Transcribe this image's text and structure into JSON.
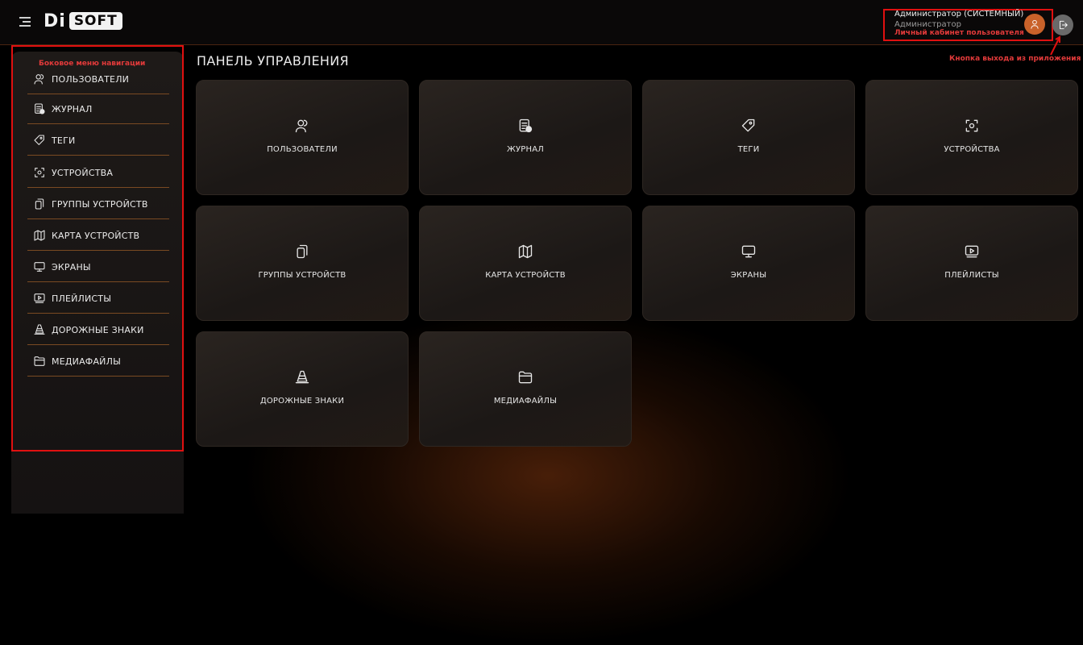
{
  "header": {
    "logo_di": "Di",
    "logo_soft": "SOFT",
    "user_name": "Администратор (СИСТЕМНЫЙ)",
    "user_role": "Администратор",
    "user_cabinet_annotation": "Личный кабинет пользователя",
    "logout_annotation": "Кнопка выхода из приложения"
  },
  "sidebar": {
    "annotation": "Боковое меню навигации",
    "items": [
      {
        "label": "пользователи",
        "icon": "users-icon"
      },
      {
        "label": "журнал",
        "icon": "journal-icon"
      },
      {
        "label": "теги",
        "icon": "tag-icon"
      },
      {
        "label": "устройства",
        "icon": "device-scan-icon"
      },
      {
        "label": "группы устройств",
        "icon": "device-group-icon"
      },
      {
        "label": "карта устройств",
        "icon": "map-icon"
      },
      {
        "label": "экраны",
        "icon": "monitor-icon"
      },
      {
        "label": "плейлисты",
        "icon": "playlist-icon"
      },
      {
        "label": "дорожные знаки",
        "icon": "traffic-cone-icon"
      },
      {
        "label": "медиафайлы",
        "icon": "folder-icon"
      }
    ]
  },
  "main": {
    "title": "ПАНЕЛЬ УПРАВЛЕНИЯ",
    "cards": [
      {
        "label": "пользователи",
        "icon": "users-icon"
      },
      {
        "label": "журнал",
        "icon": "journal-icon"
      },
      {
        "label": "теги",
        "icon": "tag-icon"
      },
      {
        "label": "устройства",
        "icon": "device-scan-icon"
      },
      {
        "label": "группы устройств",
        "icon": "device-group-icon"
      },
      {
        "label": "карта устройств",
        "icon": "map-icon"
      },
      {
        "label": "экраны",
        "icon": "monitor-icon"
      },
      {
        "label": "плейлисты",
        "icon": "playlist-icon"
      },
      {
        "label": "дорожные знаки",
        "icon": "traffic-cone-icon"
      },
      {
        "label": "медиафайлы",
        "icon": "folder-icon"
      }
    ]
  },
  "colors": {
    "accent": "#c9622a",
    "annotation": "#e01010",
    "divider": "#7a4a22"
  }
}
